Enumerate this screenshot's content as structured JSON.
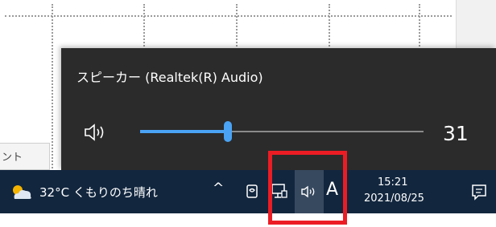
{
  "sheet": {
    "tab_label": "ント"
  },
  "flyout": {
    "device_name": "スピーカー (Realtek(R) Audio)",
    "volume": 31,
    "volume_text": "31",
    "accent": "#4aa3f4"
  },
  "taskbar": {
    "weather_text": "32°C くもりのち晴れ",
    "chevron": "^",
    "ime_indicator": "A",
    "time": "15:21",
    "date": "2021/08/25"
  },
  "icons": [
    "cloud-sun-icon",
    "chevron-up-icon",
    "pen-icon",
    "network-icon",
    "speaker-icon",
    "notification-icon"
  ],
  "highlight_color": "#ec1c24"
}
